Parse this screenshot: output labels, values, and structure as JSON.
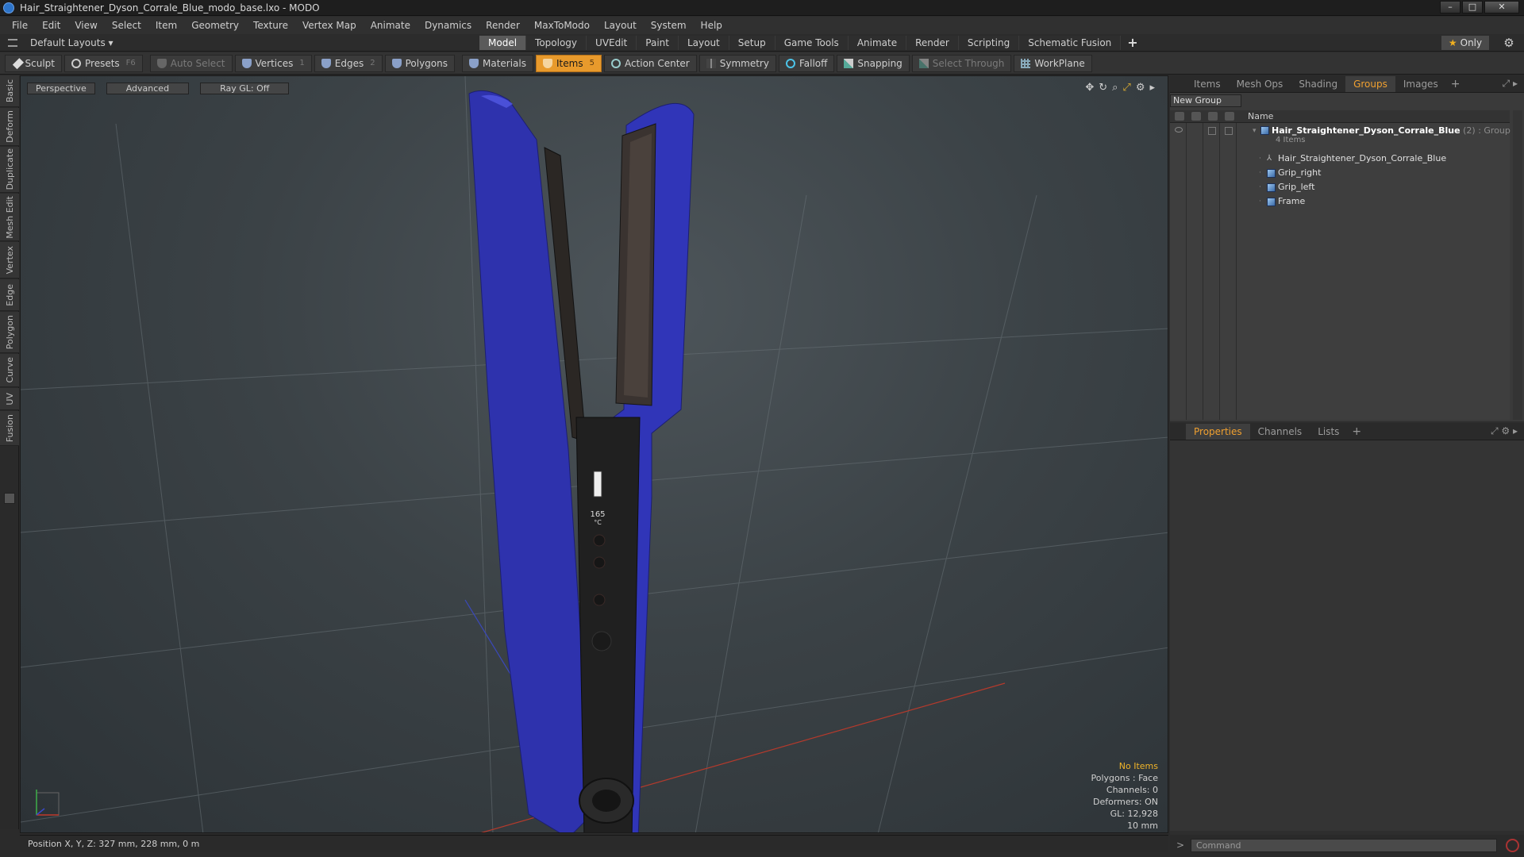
{
  "window": {
    "title": "Hair_Straightener_Dyson_Corrale_Blue_modo_base.lxo - MODO",
    "controls": [
      "–",
      "□",
      "✕"
    ]
  },
  "menubar": [
    "File",
    "Edit",
    "View",
    "Select",
    "Item",
    "Geometry",
    "Texture",
    "Vertex Map",
    "Animate",
    "Dynamics",
    "Render",
    "MaxToModo",
    "Layout",
    "System",
    "Help"
  ],
  "layoutbar": {
    "layout_select": "Default Layouts ▾",
    "tabs": [
      "Model",
      "Topology",
      "UVEdit",
      "Paint",
      "Layout",
      "Setup",
      "Game Tools",
      "Animate",
      "Render",
      "Scripting",
      "Schematic Fusion"
    ],
    "active_tab": "Model",
    "add": "+",
    "only_label": "Only"
  },
  "toolbar": {
    "sculpt": "Sculpt",
    "presets": "Presets",
    "presets_key": "F6",
    "auto_select": "Auto Select",
    "vertices": "Vertices",
    "vertices_key": "1",
    "edges": "Edges",
    "edges_key": "2",
    "polygons": "Polygons",
    "materials": "Materials",
    "items": "Items",
    "items_key": "5",
    "action_center": "Action Center",
    "symmetry": "Symmetry",
    "falloff": "Falloff",
    "snapping": "Snapping",
    "select_through": "Select Through",
    "workplane": "WorkPlane"
  },
  "left_tabs": [
    "Basic",
    "Deform",
    "Duplicate",
    "Mesh Edit",
    "Vertex",
    "Edge",
    "Polygon",
    "Curve",
    "UV",
    "Fusion"
  ],
  "viewport": {
    "view": "Perspective",
    "shading": "Advanced",
    "raygl": "Ray GL: Off",
    "display_temp": "165",
    "display_unit": "°C",
    "hud": {
      "selection": "No Items",
      "polygons": "Polygons : Face",
      "channels": "Channels: 0",
      "deformers": "Deformers: ON",
      "gl": "GL: 12,928",
      "grid": "10 mm"
    }
  },
  "statusbar": {
    "position": "Position X, Y, Z:  327 mm, 228 mm, 0 m"
  },
  "groups_panel": {
    "tabs": [
      "Items",
      "Mesh Ops",
      "Shading",
      "Groups",
      "Images"
    ],
    "active_tab": "Groups",
    "add": "+",
    "new_group": "New Group",
    "col_name": "Name",
    "root": {
      "name": "Hair_Straightener_Dyson_Corrale_Blue",
      "count": "(2)",
      "type": ": Group",
      "sub": "4 Items"
    },
    "children": [
      "Hair_Straightener_Dyson_Corrale_Blue",
      "Grip_right",
      "Grip_left",
      "Frame"
    ]
  },
  "properties_panel": {
    "tabs": [
      "Properties",
      "Channels",
      "Lists"
    ],
    "active_tab": "Properties",
    "add": "+"
  },
  "command": {
    "prompt": ">",
    "placeholder": "Command"
  },
  "colors": {
    "accent": "#e89a2c",
    "device_blue": "#2f33b8",
    "hud_warning": "#f0b429"
  }
}
